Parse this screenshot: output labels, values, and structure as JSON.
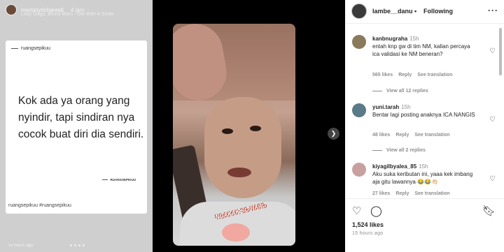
{
  "story": {
    "username": "merionyricharesti",
    "time": "4 jam",
    "music": "Lady Gaga, Bruno Mars · Die With A Smile",
    "card": {
      "brand": "ruangsepikuu",
      "quote": "Kok ada ya orang yang nyindir, tapi sindiran nya cocok buat diri dia sendiri.",
      "signature": "RUANGSEPIKUU"
    },
    "caption": "ruangsepikuu #ruangsepikuu",
    "ago": "15 hours ago"
  },
  "video": {
    "sticker_text": "NGAKAK SO HARD",
    "next_icon": "chevron-right-icon"
  },
  "post": {
    "username": "lambe__danu",
    "separator": "•",
    "follow_label": "Following",
    "more_icon": "more-horizontal-icon",
    "comments": [
      {
        "user": "kanbnugraha",
        "time": "15h",
        "text": "entah knp gw di tim NM, kalian percaya ica validasi ke NM beneran?",
        "likes": "565 likes",
        "reply": "Reply",
        "translate": "See translation",
        "view_replies": "View all 12 replies",
        "avatar_color": "#8a7a5a"
      },
      {
        "user": "yuni.tarah",
        "time": "15h",
        "text": "Bentar lagi posting anaknya ICA NANGIS",
        "likes": "48 likes",
        "reply": "Reply",
        "translate": "See translation",
        "view_replies": "View all 2 replies",
        "avatar_color": "#5a7a8a"
      },
      {
        "user": "kiyagilbyalea_85",
        "time": "15h",
        "text": "Aku suka keributan ini, yaaa kek imbang aja gitu lawannya 😂😂👏🏻",
        "likes": "27 likes",
        "reply": "Reply",
        "translate": "See translation",
        "avatar_color": "#c9a0a0"
      }
    ],
    "likes_count": "1,524 likes",
    "ago": "15 hours ago"
  }
}
